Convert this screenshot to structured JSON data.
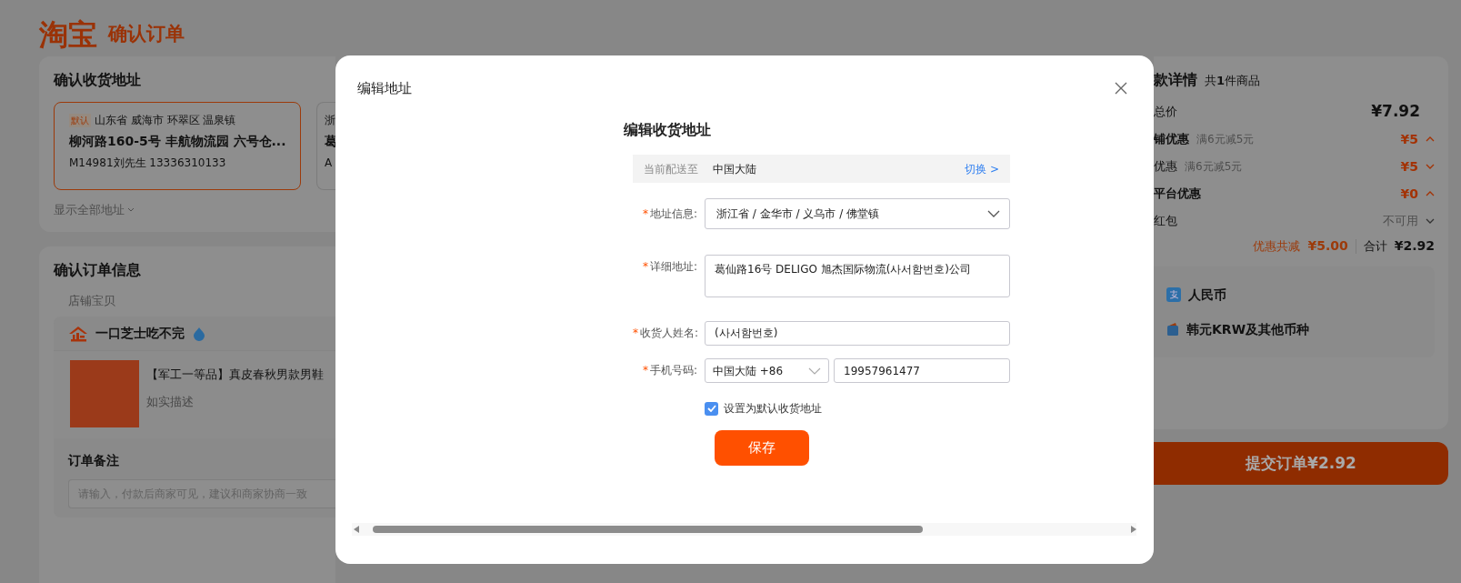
{
  "header": {
    "logo": "淘宝",
    "title": "确认订单"
  },
  "address_section": {
    "title": "确认收货地址",
    "cards": [
      {
        "tag": "默认",
        "region": "山东省 威海市 环翠区 温泉镇",
        "street": "柳河路160-5号 丰航物流园 六号仓...",
        "contact": "M14981刘先生  13336310133",
        "selected": true
      },
      {
        "region": "浙",
        "street": "葛",
        "contact": "A",
        "selected": false
      }
    ],
    "show_all": "显示全部地址"
  },
  "order_section": {
    "title": "确认订单信息",
    "subtitle": "店铺宝贝",
    "store": {
      "name": "一口芝士吃不完"
    },
    "product": {
      "title": "【军工一等品】真皮春秋男款男鞋",
      "note": "如实描述"
    },
    "remark": {
      "label": "订单备注",
      "placeholder": "请输入，付款后商家可见，建议和商家协商一致"
    }
  },
  "summary": {
    "title": "款详情",
    "count": "共**1**件商品",
    "rows": [
      {
        "kind": "price",
        "label": "总价",
        "value": "¥7.92"
      },
      {
        "kind": "group",
        "label": "铺优惠",
        "hint": "满6元减5元",
        "value": "¥5",
        "expanded": true
      },
      {
        "kind": "item",
        "label": "优惠",
        "hint": "满6元减5元",
        "value": "¥5",
        "expanded": false
      },
      {
        "kind": "group",
        "label": "平台优惠",
        "value": "¥0",
        "expanded": true
      },
      {
        "kind": "status",
        "label": "红包",
        "value": "不可用",
        "expanded": false
      }
    ],
    "total_discount_label": "优惠共减",
    "total_discount": "¥5.00",
    "total_label": "合计",
    "total": "¥2.92",
    "payment_options": [
      {
        "kind": "app",
        "label": "人民币"
      },
      {
        "kind": "card",
        "label": "韩元KRW及其他币种"
      }
    ],
    "submit": "提交订单¥2.92"
  },
  "modal": {
    "title": "编辑地址",
    "heading": "编辑收货地址",
    "destination": {
      "label": "当前配送至",
      "value": "中国大陆",
      "link": "切换 >"
    },
    "fields": [
      {
        "kind": "cascader",
        "mark": "*",
        "label": "地址信息:",
        "value": "浙江省 / 金华市 / 义乌市 / 佛堂镇"
      },
      {
        "kind": "textarea",
        "mark": "*",
        "label": "详细地址:",
        "value": "葛仙路16号 DELIGO 旭杰国际物流(사서함번호)公司"
      },
      {
        "kind": "text",
        "mark": "*",
        "label": "收货人姓名:",
        "value": "(사서함번호)"
      },
      {
        "kind": "phone",
        "mark": "*",
        "label": "手机号码:",
        "prefix": "中国大陆 +86",
        "value": "19957961477"
      }
    ],
    "default_checkbox": {
      "label": "设置为默认收货地址",
      "checked": true
    },
    "save": "保存"
  }
}
